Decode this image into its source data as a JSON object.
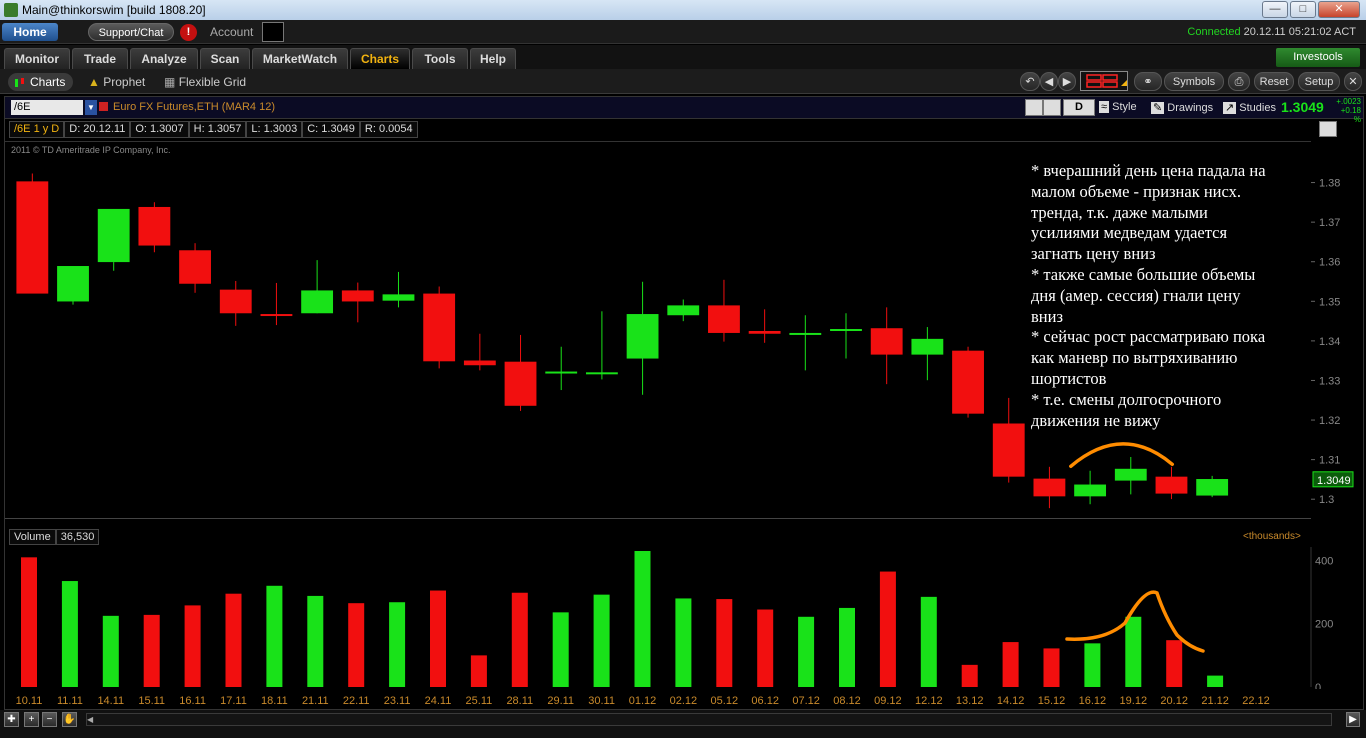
{
  "window": {
    "title": "Main@thinkorswim [build 1808.20]",
    "min_icon": "minimize-icon",
    "max_icon": "maximize-icon",
    "close_icon": "close-icon"
  },
  "topbar": {
    "home": "Home",
    "support": "Support/Chat",
    "alert": "!",
    "account_label": "Account",
    "status_connected": "Connected",
    "status_time": "20.12.11 05:21:02 ACT"
  },
  "tabs": [
    {
      "label": "Monitor",
      "active": false
    },
    {
      "label": "Trade",
      "active": false
    },
    {
      "label": "Analyze",
      "active": false
    },
    {
      "label": "Scan",
      "active": false
    },
    {
      "label": "MarketWatch",
      "active": false
    },
    {
      "label": "Charts",
      "active": true
    },
    {
      "label": "Tools",
      "active": false
    },
    {
      "label": "Help",
      "active": false
    }
  ],
  "investools": "Investools",
  "subnav": {
    "charts": "Charts",
    "prophet": "Prophet",
    "flexible_grid": "Flexible Grid",
    "symbols": "Symbols",
    "reset": "Reset",
    "setup": "Setup"
  },
  "chart_header": {
    "symbol": "/6E",
    "description": "Euro FX Futures,ETH (MAR4 12)",
    "period_button": "D",
    "style": "Style",
    "drawings": "Drawings",
    "studies": "Studies",
    "last_price": "1.3049",
    "change_abs": "+.0023",
    "change_pct": "+0.18 %"
  },
  "info_bar": {
    "period": "/6E 1 y D",
    "date": "D: 20.12.11",
    "open": "O: 1.3007",
    "high": "H: 1.3057",
    "low": "L: 1.3003",
    "close": "C: 1.3049",
    "range": "R: 0.0054"
  },
  "copyright": "2011 © TD Ameritrade IP Company, Inc.",
  "volume_header": {
    "label": "Volume",
    "value": "36,530",
    "units": "<thousands>"
  },
  "annotation": [
    "* вчерашний день цена падала на",
    "малом объеме - признак нисх.",
    "тренда, т.к. даже малыми",
    "усилиями медведам удается",
    "загнать цену вниз",
    "* также самые большие объемы",
    "дня (амер. сессия) гнали цену",
    "вниз",
    "* сейчас рост рассматриваю пока",
    "как маневр по вытряхиванию",
    "шортистов",
    "* т.е. смены долгосрочного",
    "движения не вижу"
  ],
  "colors": {
    "up": "#19e219",
    "down": "#f20f0f",
    "accent": "#f2b310",
    "annotation_curve": "#ff8c00"
  },
  "chart_data": [
    {
      "type": "candlestick",
      "title": "/6E 1 y D",
      "ylim": [
        1.295,
        1.3905
      ],
      "y_ticks": [
        "1.38",
        "1.37",
        "1.36",
        "1.35",
        "1.34",
        "1.33",
        "1.32",
        "1.31",
        "1.3"
      ],
      "last_price_label": "1.3049",
      "candles": [
        {
          "o": 1.3805,
          "h": 1.3825,
          "l": 1.3535,
          "c": 1.352
        },
        {
          "o": 1.35,
          "h": 1.353,
          "l": 1.3492,
          "c": 1.359
        },
        {
          "o": 1.36,
          "h": 1.36,
          "l": 1.3578,
          "c": 1.3735
        },
        {
          "o": 1.374,
          "h": 1.3752,
          "l": 1.3625,
          "c": 1.3642
        },
        {
          "o": 1.363,
          "h": 1.3648,
          "l": 1.3522,
          "c": 1.3545
        },
        {
          "o": 1.353,
          "h": 1.3552,
          "l": 1.3438,
          "c": 1.347
        },
        {
          "o": 1.3468,
          "h": 1.3547,
          "l": 1.344,
          "c": 1.3466
        },
        {
          "o": 1.347,
          "h": 1.3605,
          "l": 1.347,
          "c": 1.3528
        },
        {
          "o": 1.3528,
          "h": 1.3548,
          "l": 1.3447,
          "c": 1.35
        },
        {
          "o": 1.3502,
          "h": 1.3575,
          "l": 1.3485,
          "c": 1.3518
        },
        {
          "o": 1.352,
          "h": 1.3538,
          "l": 1.333,
          "c": 1.3348
        },
        {
          "o": 1.335,
          "h": 1.3418,
          "l": 1.3325,
          "c": 1.3338
        },
        {
          "o": 1.3347,
          "h": 1.3415,
          "l": 1.3222,
          "c": 1.3235
        },
        {
          "o": 1.3317,
          "h": 1.3385,
          "l": 1.3275,
          "c": 1.3322
        },
        {
          "o": 1.3315,
          "h": 1.3475,
          "l": 1.3302,
          "c": 1.332
        },
        {
          "o": 1.3355,
          "h": 1.355,
          "l": 1.3263,
          "c": 1.3468
        },
        {
          "o": 1.3465,
          "h": 1.3505,
          "l": 1.345,
          "c": 1.349
        },
        {
          "o": 1.349,
          "h": 1.3555,
          "l": 1.3398,
          "c": 1.342
        },
        {
          "o": 1.3425,
          "h": 1.348,
          "l": 1.3395,
          "c": 1.3418
        },
        {
          "o": 1.3415,
          "h": 1.3465,
          "l": 1.3325,
          "c": 1.342
        },
        {
          "o": 1.3425,
          "h": 1.347,
          "l": 1.3355,
          "c": 1.343
        },
        {
          "o": 1.3432,
          "h": 1.3485,
          "l": 1.329,
          "c": 1.3365
        },
        {
          "o": 1.3365,
          "h": 1.3435,
          "l": 1.33,
          "c": 1.3405
        },
        {
          "o": 1.3375,
          "h": 1.3385,
          "l": 1.3205,
          "c": 1.3215
        },
        {
          "o": 1.319,
          "h": 1.3255,
          "l": 1.304,
          "c": 1.3055
        },
        {
          "o": 1.305,
          "h": 1.308,
          "l": 1.2975,
          "c": 1.3005
        },
        {
          "o": 1.3005,
          "h": 1.307,
          "l": 1.2985,
          "c": 1.3035
        },
        {
          "o": 1.3045,
          "h": 1.3105,
          "l": 1.301,
          "c": 1.3075
        },
        {
          "o": 1.3055,
          "h": 1.308,
          "l": 1.2998,
          "c": 1.3012
        },
        {
          "o": 1.3007,
          "h": 1.3057,
          "l": 1.3003,
          "c": 1.3049
        }
      ]
    },
    {
      "type": "bar",
      "title": "Volume",
      "ylabel": "<thousands>",
      "ylim": [
        0,
        430
      ],
      "y_ticks": [
        "400",
        "200",
        "0"
      ],
      "categories": [
        "10.11",
        "11.11",
        "14.11",
        "15.11",
        "16.11",
        "17.11",
        "18.11",
        "21.11",
        "22.11",
        "23.11",
        "24.11",
        "25.11",
        "28.11",
        "29.11",
        "30.11",
        "01.12",
        "02.12",
        "05.12",
        "06.12",
        "07.12",
        "08.12",
        "09.12",
        "12.12",
        "13.12",
        "14.12",
        "15.12",
        "16.12",
        "19.12",
        "20.12",
        "21.12",
        "22.12"
      ],
      "values": [
        410,
        335,
        225,
        228,
        258,
        295,
        320,
        288,
        265,
        268,
        305,
        100,
        298,
        236,
        292,
        430,
        280,
        278,
        245,
        222,
        250,
        365,
        285,
        70,
        142,
        122,
        138,
        222,
        148,
        36
      ],
      "up": [
        false,
        true,
        true,
        false,
        false,
        false,
        true,
        true,
        false,
        true,
        false,
        false,
        false,
        true,
        true,
        true,
        true,
        false,
        false,
        true,
        true,
        false,
        true,
        false,
        false,
        false,
        true,
        true,
        false,
        true
      ]
    }
  ]
}
